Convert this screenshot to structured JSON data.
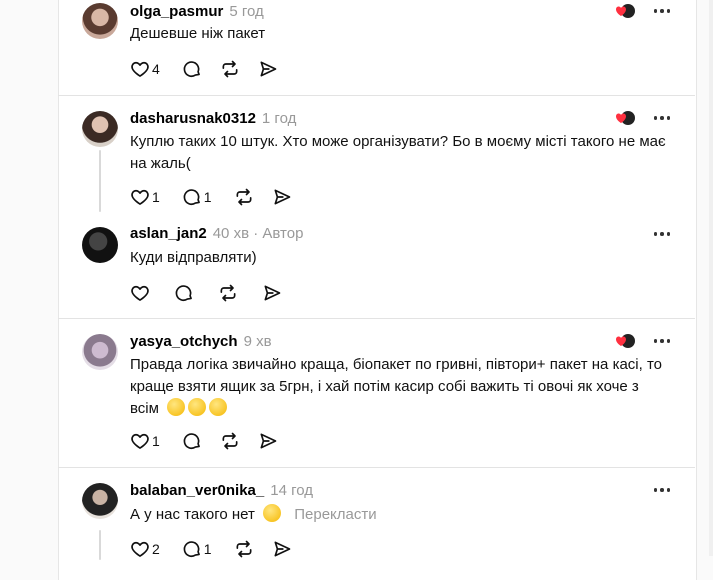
{
  "posts": [
    {
      "username": "olga_pasmur",
      "time": "5 год",
      "text": "Дешевше ніж пакет",
      "likes": "4",
      "replies": "",
      "liked_badge": true
    },
    {
      "username": "dasharusnak0312",
      "time": "1 год",
      "text": "Куплю таких 10 штук. Хто може організувати? Бо в моєму місті такого не має на жаль(",
      "likes": "1",
      "replies": "1",
      "liked_badge": true
    },
    {
      "username": "aslan_jan2",
      "time": "40 хв",
      "author_label": "· Автор",
      "text": "Куди відправляти)",
      "likes": "",
      "replies": ""
    },
    {
      "username": "yasya_otchych",
      "time": "9 хв",
      "text": "Правда логіка звичайно краща, біопакет по гривні, півтори+ пакет на касі, то краще взяти ящик за 5грн, і хай потім касир собі важить ті овочі як хоче з всім",
      "emojis": [
        "tired-face",
        "laughing-face",
        "grinning-face"
      ],
      "likes": "1",
      "replies": "",
      "liked_badge": true
    },
    {
      "username": "balaban_ver0nika_",
      "time": "14 год",
      "text": "А у нас такого нет",
      "emoji": "frowning-face",
      "translate_label": "Перекласти",
      "likes": "2",
      "replies": "1"
    }
  ],
  "colors": {
    "panel": "#ffffff",
    "background": "#fafafa",
    "secondary_text": "#999999",
    "separator": "#e3e3e3",
    "like_badge": "#ff3040"
  }
}
